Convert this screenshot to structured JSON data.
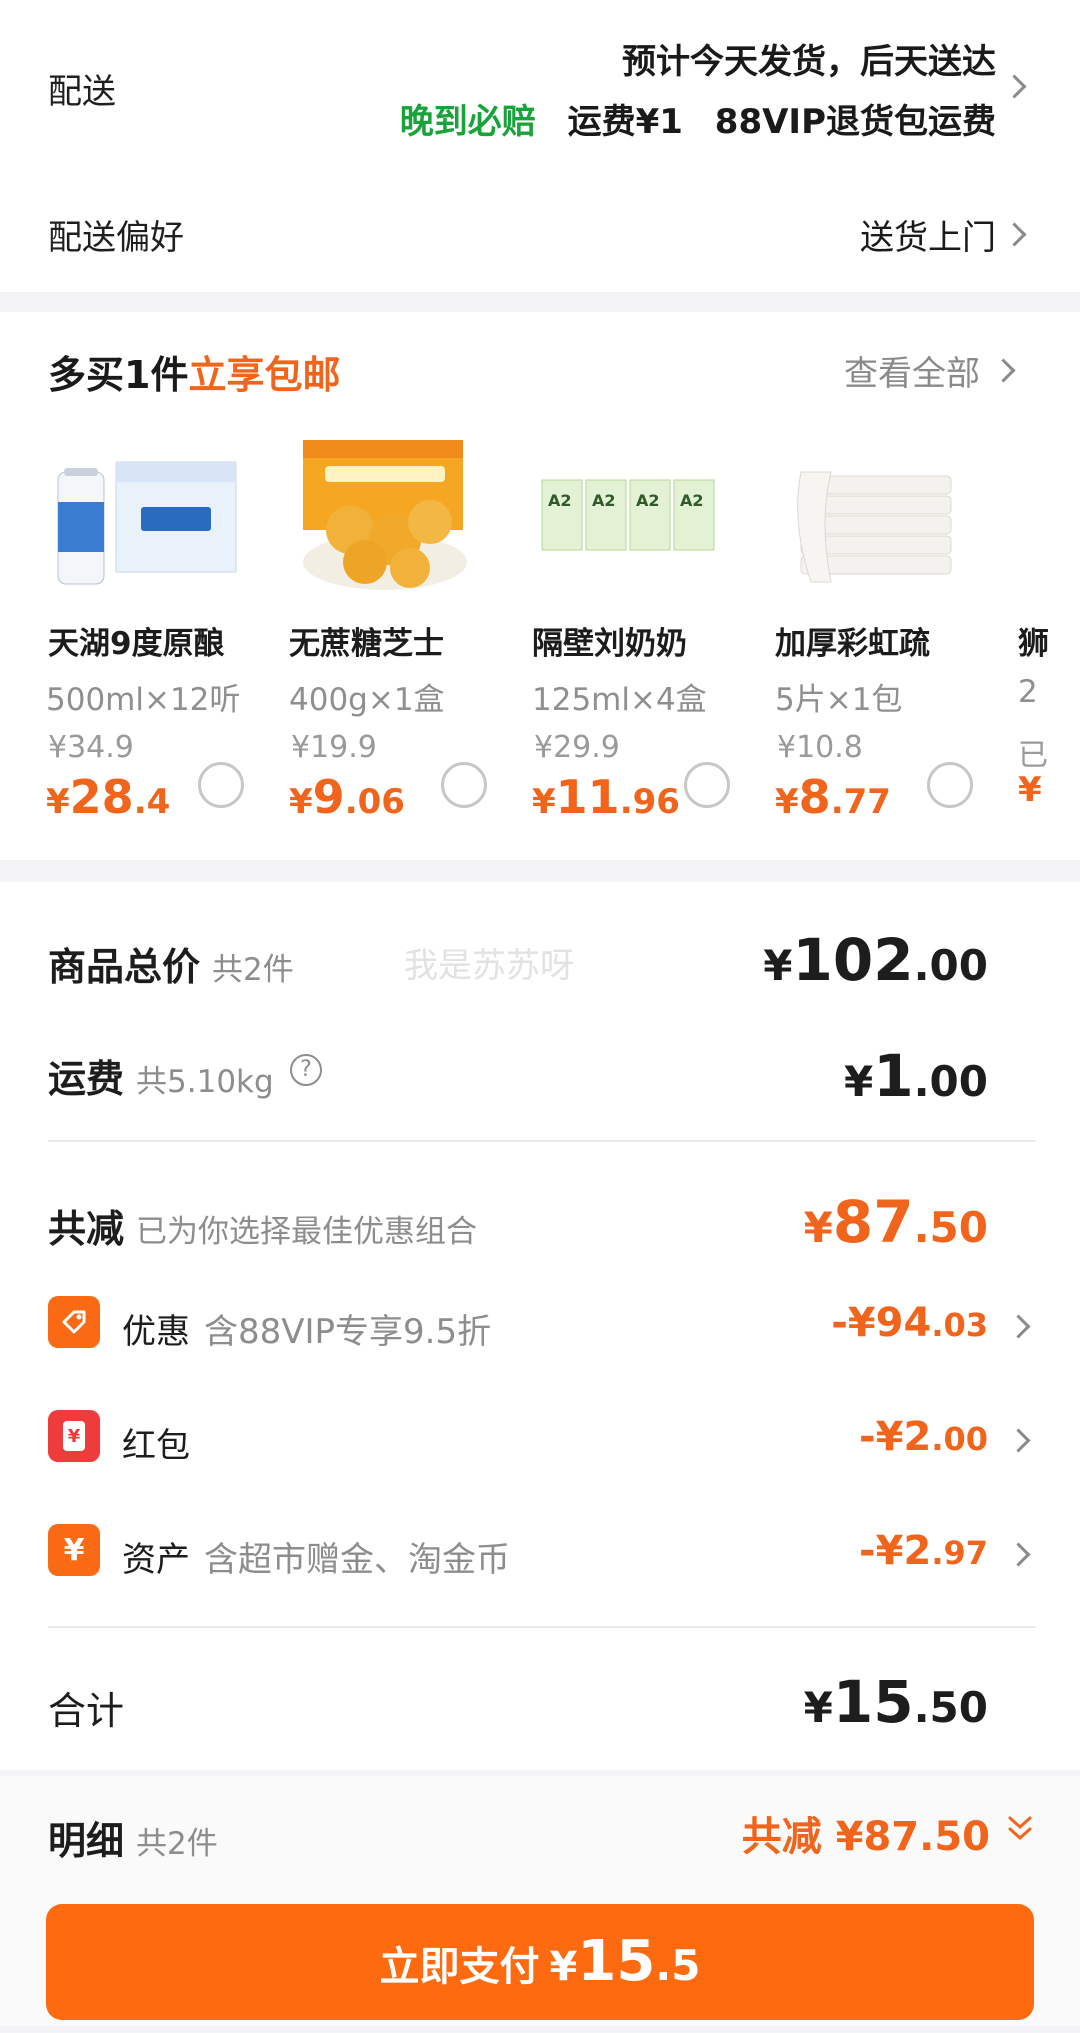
{
  "shipping": {
    "label": "配送",
    "eta": "预计今天发货，后天送达",
    "guarantee": "晚到必赔",
    "fee": "运费¥1",
    "vip_return": "88VIP退货包运费"
  },
  "preference": {
    "label": "配送偏好",
    "value": "送货上门"
  },
  "recommend": {
    "title_prefix": "多买1件",
    "title_highlight": "立享包邮",
    "view_all": "查看全部",
    "products": [
      {
        "name": "天湖9度原酿",
        "spec": "500ml×12听",
        "orig": "¥34.9",
        "yen": "¥",
        "int": "28",
        "dec": ".4"
      },
      {
        "name": "无蔗糖芝士",
        "spec": "400g×1盒",
        "orig": "¥19.9",
        "yen": "¥",
        "int": "9",
        "dec": ".06"
      },
      {
        "name": "隔壁刘奶奶",
        "spec": "125ml×4盒",
        "orig": "¥29.9",
        "yen": "¥",
        "int": "11",
        "dec": ".96"
      },
      {
        "name": "加厚彩虹疏",
        "spec": "5片×1包",
        "orig": "¥10.8",
        "yen": "¥",
        "int": "8",
        "dec": ".77"
      },
      {
        "name": "狮",
        "spec": "2",
        "orig": "已",
        "yen": "¥",
        "int": "",
        "dec": ""
      }
    ]
  },
  "summary": {
    "total_label": "商品总价",
    "total_count": "共2件",
    "watermark": "我是苏苏呀",
    "total_yen": "¥",
    "total_int": "102",
    "total_dec": ".00",
    "freight_label": "运费",
    "freight_weight": "共5.10kg",
    "help_glyph": "?",
    "freight_yen": "¥",
    "freight_int": "1",
    "freight_dec": ".00",
    "reduce_label": "共减",
    "reduce_note": "已为你选择最佳优惠组合",
    "reduce_yen": "¥",
    "reduce_int": "87",
    "reduce_dec": ".50",
    "discounts": [
      {
        "icon": "coupon-tag-icon",
        "glyph": "",
        "label": "优惠",
        "sub": "含88VIP专享9.5折",
        "int": "-¥94",
        "dec": ".03"
      },
      {
        "icon": "red-packet-icon",
        "glyph": "¥",
        "label": "红包",
        "sub": "",
        "int": "-¥2",
        "dec": ".00"
      },
      {
        "icon": "asset-yen-icon",
        "glyph": "¥",
        "label": "资产",
        "sub": "含超市赠金、淘金币",
        "int": "-¥2",
        "dec": ".97"
      }
    ],
    "sum_label": "合计",
    "sum_yen": "¥",
    "sum_int": "15",
    "sum_dec": ".50"
  },
  "footer": {
    "detail_label": "明细",
    "detail_count": "共2件",
    "reduce_text": "共减 ¥87.50",
    "pay_label": "立即支付",
    "pay_yen": "¥",
    "pay_int": "15",
    "pay_dec": ".5"
  },
  "colors": {
    "accent": "#f0641c",
    "green": "#1aa33a",
    "pay_button": "#fe6a10"
  }
}
